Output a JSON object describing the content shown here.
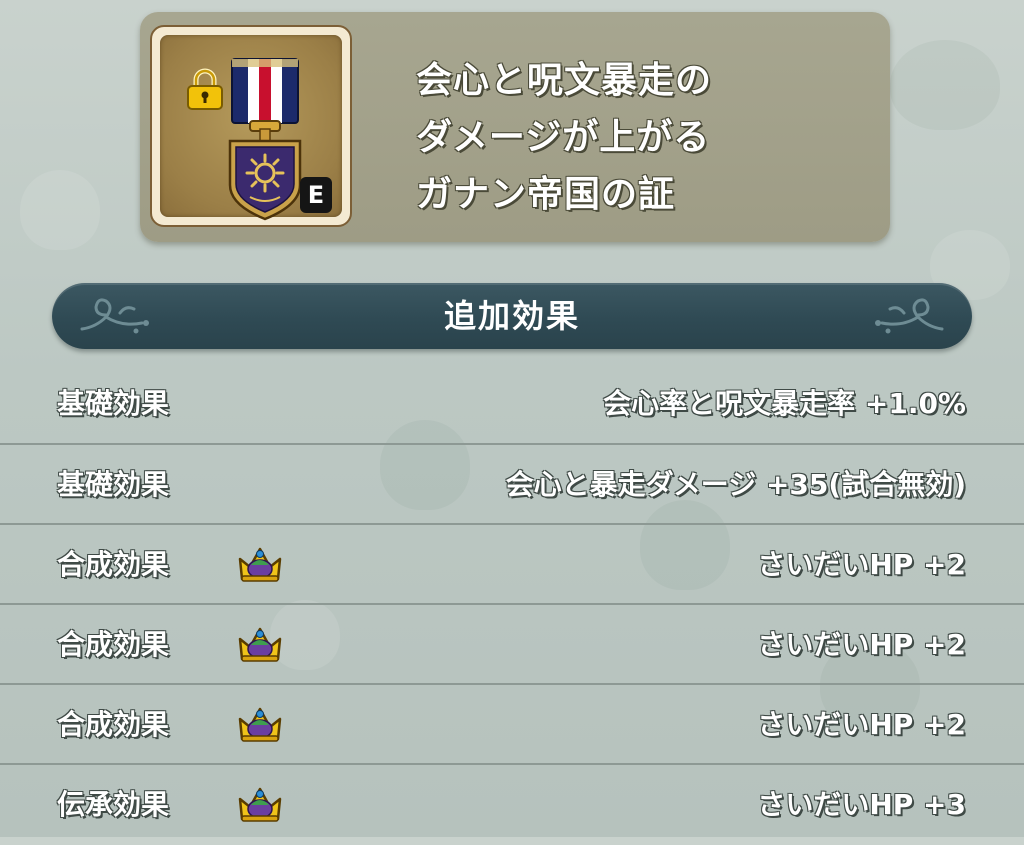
{
  "item": {
    "title_lines": [
      "会心と呪文暴走の",
      "ダメージが上がる",
      "ガナン帝国の証"
    ],
    "equip_badge": "E",
    "icons": {
      "lock": "lock-icon",
      "medal": "medal-icon"
    }
  },
  "section": {
    "title": "追加効果"
  },
  "effects": [
    {
      "type": "基礎効果",
      "icon": null,
      "value": "会心率と呪文暴走率 +1.0%"
    },
    {
      "type": "基礎効果",
      "icon": null,
      "value": "会心と暴走ダメージ +35(試合無効)"
    },
    {
      "type": "合成効果",
      "icon": "crown-icon",
      "value": "さいだいHP +2"
    },
    {
      "type": "合成効果",
      "icon": "crown-icon",
      "value": "さいだいHP +2"
    },
    {
      "type": "合成効果",
      "icon": "crown-icon",
      "value": "さいだいHP +2"
    },
    {
      "type": "伝承効果",
      "icon": "crown-icon",
      "value": "さいだいHP +3"
    }
  ],
  "colors": {
    "card": "#9e9c85",
    "banner": "#2f4a54",
    "row_divider": "#8d9994",
    "medal_ribbon": [
      "#1c2a6b",
      "#ffffff",
      "#c8102e"
    ],
    "medal_shield": "#3b2a6e",
    "lock": "#f2c20a"
  }
}
